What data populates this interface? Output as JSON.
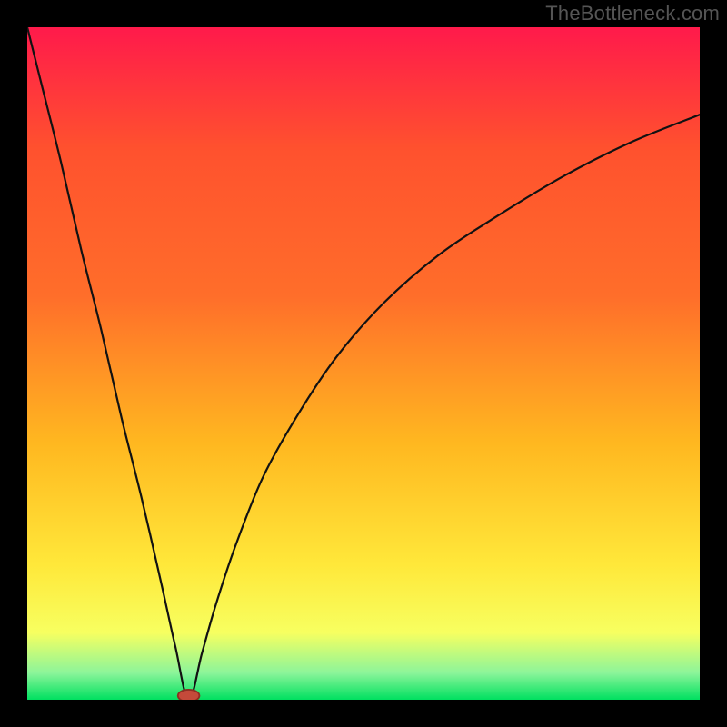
{
  "watermark": "TheBottleneck.com",
  "colors": {
    "frame": "#000000",
    "grad_top": "#ff1a4b",
    "grad_mid1": "#ff6e2a",
    "grad_mid2": "#ffb820",
    "grad_mid3": "#ffe83a",
    "grad_mid4": "#f7ff60",
    "grad_low": "#d9ffb0",
    "grad_bottom": "#00e060",
    "curve": "#121212",
    "marker_fill": "#c44a3a",
    "marker_stroke": "#8c2f22"
  },
  "chart_data": {
    "type": "line",
    "title": "",
    "xlabel": "",
    "ylabel": "",
    "xlim": [
      0,
      100
    ],
    "ylim": [
      0,
      100
    ],
    "note": "y ≈ |log(x) − log(x0)| style bottleneck curve; minimum at x≈24, reaches ~100 at x≈0 and ~87 at x=100",
    "series": [
      {
        "name": "bottleneck-curve",
        "x": [
          0,
          2,
          5,
          8,
          11,
          14,
          17,
          20,
          22,
          24,
          26,
          28,
          31,
          35,
          40,
          46,
          53,
          61,
          70,
          80,
          90,
          100
        ],
        "y": [
          100,
          92,
          80,
          67,
          55,
          42,
          30,
          17,
          8,
          0,
          7,
          14,
          23,
          33,
          42,
          51,
          59,
          66,
          72,
          78,
          83,
          87
        ]
      }
    ],
    "marker": {
      "x": 24,
      "y": 0,
      "rx": 1.6,
      "ry": 0.9
    }
  }
}
